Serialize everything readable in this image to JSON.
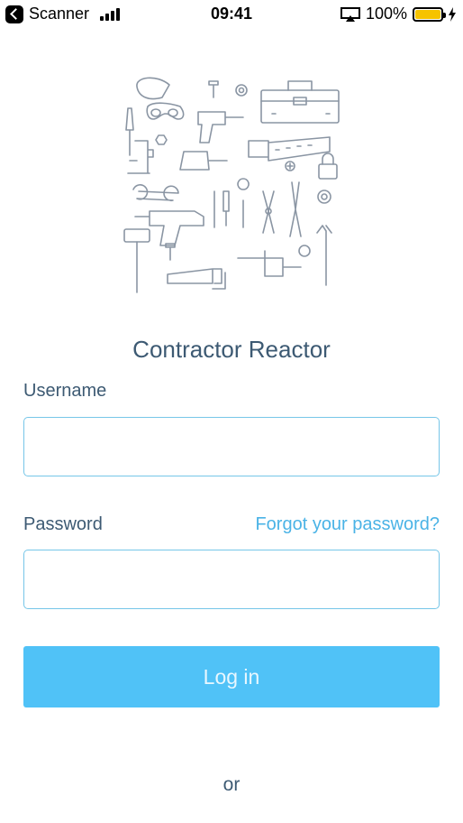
{
  "status_bar": {
    "back_app": "Scanner",
    "time": "09:41",
    "battery_text": "100%",
    "battery_level": 1.0,
    "battery_color": "#f6c300",
    "icons": [
      "back-icon",
      "signal-icon",
      "airplay-icon",
      "battery-icon",
      "charging-icon"
    ]
  },
  "illustration": {
    "icon": "tools-illustration-icon"
  },
  "app_title": "Contractor Reactor",
  "form": {
    "username_label": "Username",
    "username_value": "",
    "password_label": "Password",
    "password_value": "",
    "forgot_link": "Forgot your password?",
    "login_button": "Log in",
    "or_text": "or"
  },
  "colors": {
    "primary": "#50c2f7",
    "link": "#4ab3e6",
    "text": "#3d5a73",
    "input_border": "#76c6e8"
  }
}
